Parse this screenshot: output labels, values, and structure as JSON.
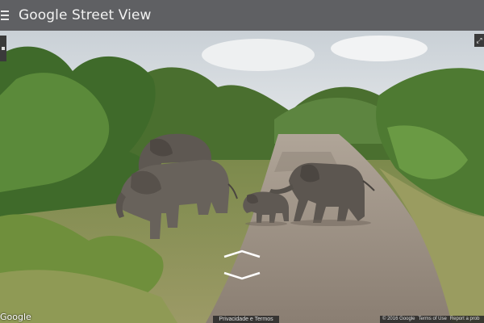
{
  "header": {
    "app_title": "Google Street View",
    "menu_icon": "hamburger-menu-icon"
  },
  "scene": {
    "description_free": true,
    "sky_color": "#d8dde0",
    "road_color": "#9b8f82",
    "foliage_color": "#4f7a36"
  },
  "navigation": {
    "forward_icon": "chevron-up-icon",
    "back_icon": "chevron-down-icon"
  },
  "footer": {
    "logo_text": "Google",
    "privacy_label": "Privacidade e Termos",
    "copyright": "© 2016 Google",
    "terms_label": "Terms of Use",
    "report_label": "Report a prob"
  },
  "controls": {
    "right_button_icon": "expand-icon"
  }
}
